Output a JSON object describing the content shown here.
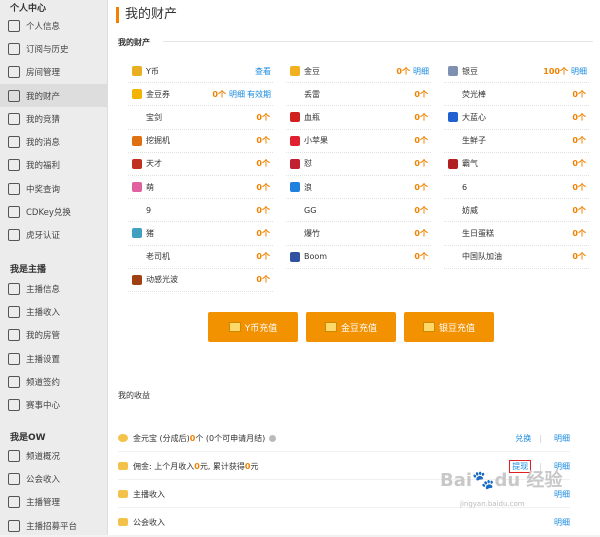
{
  "sidebar": {
    "group1_title": "个人中心",
    "group1": [
      {
        "label": "个人信息",
        "icon": "home-icon"
      },
      {
        "label": "订阅与历史",
        "icon": "heart-icon"
      },
      {
        "label": "房间管理",
        "icon": "house-icon"
      },
      {
        "label": "我的财产",
        "icon": "wallet-icon",
        "active": true
      },
      {
        "label": "我的竞猜",
        "icon": "quiz-icon"
      },
      {
        "label": "我的消息",
        "icon": "message-icon"
      },
      {
        "label": "我的福利",
        "icon": "gift-icon"
      },
      {
        "label": "中奖查询",
        "icon": "prize-icon"
      },
      {
        "label": "CDKey兑换",
        "icon": "shuffle-icon"
      },
      {
        "label": "虎牙认证",
        "icon": "shield-icon"
      }
    ],
    "group2_title": "我是主播",
    "group2": [
      {
        "label": "主播信息",
        "icon": "id-card-icon"
      },
      {
        "label": "主播收入",
        "icon": "income-icon"
      },
      {
        "label": "我的房管",
        "icon": "manager-icon"
      },
      {
        "label": "主播设置",
        "icon": "settings-icon"
      },
      {
        "label": "频道签约",
        "icon": "contract-icon"
      },
      {
        "label": "赛事中心",
        "icon": "trophy-icon"
      }
    ],
    "group3_title": "我是OW",
    "group3": [
      {
        "label": "频道概况",
        "icon": "channel-icon"
      },
      {
        "label": "公会收入",
        "icon": "guild-income-icon"
      },
      {
        "label": "主播管理",
        "icon": "anchor-manage-icon"
      },
      {
        "label": "主播招募平台",
        "icon": "recruit-icon"
      }
    ]
  },
  "header": {
    "title": "我的财产"
  },
  "assets": {
    "section_title": "我的财产",
    "col1": [
      {
        "name": "Y币",
        "link": "查看",
        "icon_color": "#e8b020"
      },
      {
        "name": "金豆券",
        "count": "0个",
        "link": "明细",
        "link2": "有效期",
        "icon_color": "#f2b400"
      },
      {
        "name": "宝剑",
        "count": "0个"
      },
      {
        "name": "挖掘机",
        "count": "0个",
        "icon_color": "#e07010"
      },
      {
        "name": "天才",
        "count": "0个",
        "icon_color": "#c03020"
      },
      {
        "name": "萌",
        "count": "0个",
        "icon_color": "#e060a0"
      },
      {
        "name": "9",
        "count": "0个"
      },
      {
        "name": "猪",
        "count": "0个",
        "icon_color": "#40a0c0"
      },
      {
        "name": "老司机",
        "count": "0个"
      },
      {
        "name": "动感光波",
        "count": "0个",
        "icon_color": "#a04010"
      }
    ],
    "col2": [
      {
        "name": "金豆",
        "count": "0个",
        "link": "明细",
        "icon_color": "#f0b020"
      },
      {
        "name": "丢雷",
        "count": "0个"
      },
      {
        "name": "血瓶",
        "count": "0个",
        "icon_color": "#d02020"
      },
      {
        "name": "小苹果",
        "count": "0个",
        "icon_color": "#e02030"
      },
      {
        "name": "怼",
        "count": "0个",
        "icon_color": "#c02030"
      },
      {
        "name": "浪",
        "count": "0个",
        "icon_color": "#2080e0"
      },
      {
        "name": "GG",
        "count": "0个"
      },
      {
        "name": "爆竹",
        "count": "0个"
      },
      {
        "name": "Boom",
        "count": "0个",
        "icon_color": "#3050a0"
      }
    ],
    "col3": [
      {
        "name": "银豆",
        "count": "100个",
        "link": "明细",
        "icon_color": "#8090b0"
      },
      {
        "name": "荧光棒",
        "count": "0个"
      },
      {
        "name": "大蓝心",
        "count": "0个",
        "icon_color": "#2060d0"
      },
      {
        "name": "生鲜子",
        "count": "0个"
      },
      {
        "name": "霸气",
        "count": "0个",
        "icon_color": "#b02020"
      },
      {
        "name": "6",
        "count": "0个"
      },
      {
        "name": "妨威",
        "count": "0个"
      },
      {
        "name": "生日蛋糕",
        "count": "0个"
      },
      {
        "name": "中国队加油",
        "count": "0个"
      }
    ]
  },
  "buttons": {
    "ycoin": "Y币充值",
    "gold": "金豆充值",
    "silver": "银豆充值"
  },
  "income": {
    "section_title": "我的收益",
    "row1": {
      "a": "金元宝 (分成后) ",
      "v1": "0",
      "b": "个 (0个可申请月结)",
      "exchange": "兑换",
      "detail": "明细"
    },
    "row2": {
      "a": "佣金: 上个月收入 ",
      "v1": "0",
      "b": "元, 累计获得 ",
      "v2": "0",
      "c": "元",
      "withdraw": "提现",
      "detail": "明细"
    },
    "row3": {
      "a": "主播收入",
      "detail": "明细"
    },
    "row4": {
      "a": "公会收入",
      "detail": "明细"
    }
  },
  "watermark": {
    "text": "Baidu 经验",
    "sub": "jingyan.baidu.com"
  }
}
